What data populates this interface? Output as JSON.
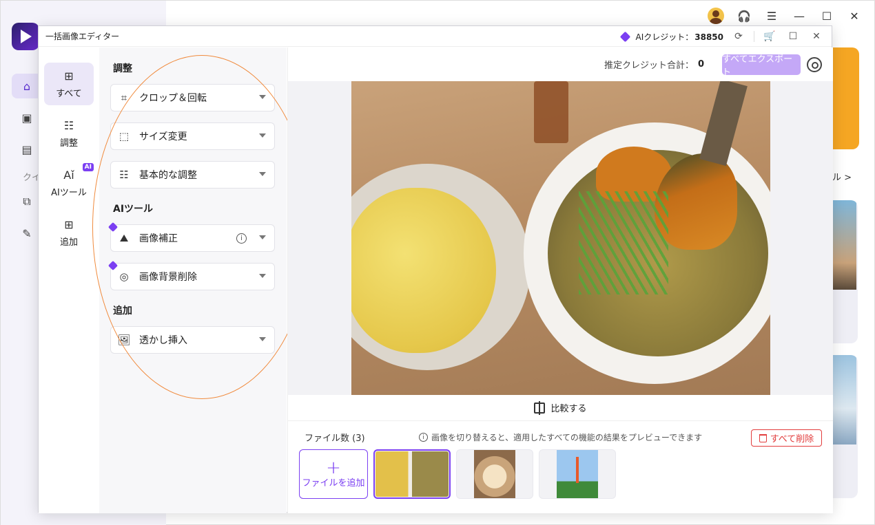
{
  "window": {
    "title": "一括画像エディター",
    "ai_credit_label": "AIクレジット：",
    "ai_credit_value": "38850"
  },
  "rail": {
    "items": [
      {
        "label": "すべて",
        "icon": "grid-icon"
      },
      {
        "label": "調整",
        "icon": "sliders-icon"
      },
      {
        "label": "AIツール",
        "icon": "ai-icon",
        "badge": "AI"
      },
      {
        "label": "追加",
        "icon": "plus-box-icon"
      }
    ]
  },
  "panel": {
    "sections": [
      {
        "title": "調整"
      },
      {
        "title": "AIツール"
      },
      {
        "title": "追加"
      }
    ],
    "tools": [
      {
        "label": "クロップ＆回転",
        "icon": "crop-rotate-icon"
      },
      {
        "label": "サイズ変更",
        "icon": "resize-icon"
      },
      {
        "label": "基本的な調整",
        "icon": "sliders-icon"
      },
      {
        "label": "画像補正",
        "icon": "image-enhance-icon"
      },
      {
        "label": "画像背景削除",
        "icon": "background-remove-icon"
      },
      {
        "label": "透かし挿入",
        "icon": "watermark-icon"
      }
    ]
  },
  "topbar": {
    "estimate_label": "推定クレジット合計：",
    "estimate_value": "0",
    "export_label": "すべてエクスポート"
  },
  "compare_label": "比較する",
  "files": {
    "count_label": "ファイル数 (3)",
    "hint": "画像を切り替えると、適用したすべての機能の結果をプレビューできます",
    "delete_all": "すべて削除",
    "add_file": "ファイルを追加"
  },
  "background": {
    "side_label": "クイ",
    "tool_link": "ル >"
  },
  "colors": {
    "accent": "#7b3ff2",
    "export_disabled": "#c4a8f7",
    "danger": "#e23b3b",
    "annotation": "#f08a3c"
  }
}
